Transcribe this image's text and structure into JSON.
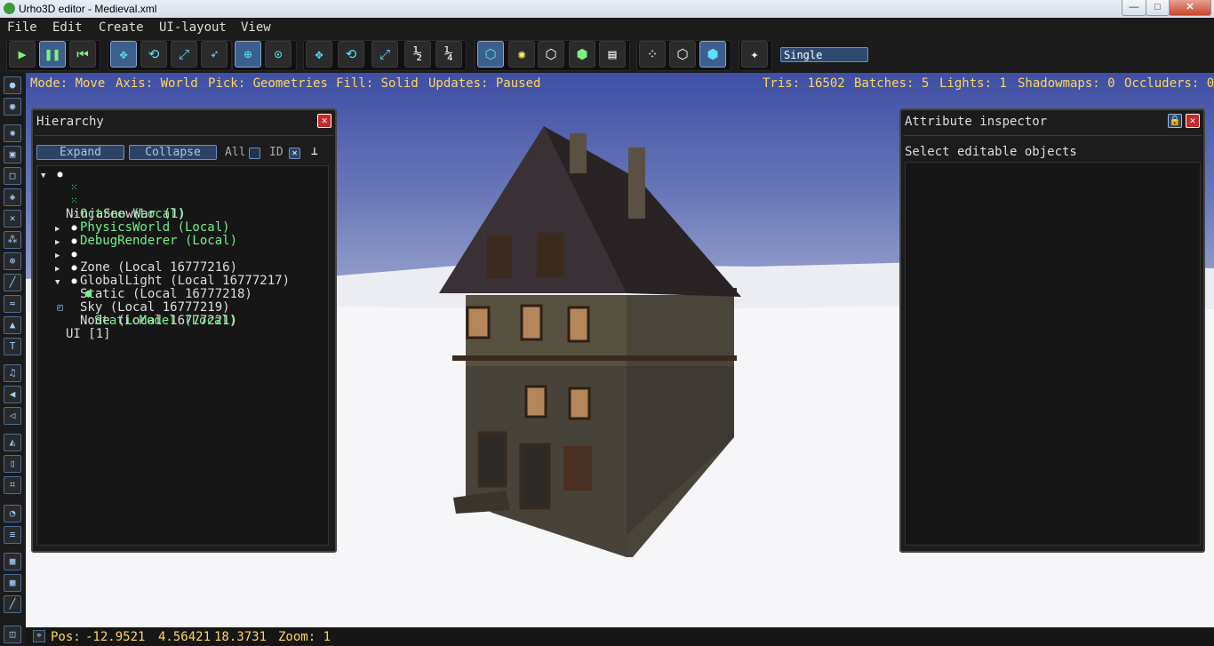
{
  "window": {
    "title": "Urho3D editor - Medieval.xml",
    "minimize_glyph": "—",
    "maximize_glyph": "□",
    "close_glyph": "✕"
  },
  "menu": [
    "File",
    "Edit",
    "Create",
    "UI-layout",
    "View"
  ],
  "toolbar": {
    "run_icons": [
      "play-icon",
      "pause-icon",
      "rewind-icon"
    ],
    "edit_mode_icons": [
      "move-gizmo-icon",
      "rotate-gizmo-icon",
      "scale-gizmo-icon",
      "select-gizmo-icon"
    ],
    "axis_icons": [
      "world-axis-icon",
      "local-axis-icon"
    ],
    "snap_icons": [
      "snap-move-icon",
      "snap-rotate-icon",
      "snap-scale-icon",
      "snap-half-icon",
      "snap-quarter-icon"
    ],
    "pick_icons": [
      "pick-geometry-icon",
      "pick-light-icon",
      "pick-zone-icon",
      "pick-rigidbody-icon",
      "pick-ui-icon"
    ],
    "fill_icons": [
      "fill-point-icon",
      "fill-wireframe-icon",
      "fill-solid-icon"
    ],
    "view_icons": [
      "view-mode-icon"
    ],
    "view_mode_value": "Single",
    "snap_half_label": "½",
    "snap_quarter_label": "¼"
  },
  "status": {
    "mode": "Mode: Move",
    "axis": "Axis: World",
    "pick": "Pick: Geometries",
    "fill": "Fill: Solid",
    "updates": "Updates: Paused",
    "tris": "Tris: 16502",
    "batches": "Batches: 5",
    "lights": "Lights: 1",
    "shadowmaps": "Shadowmaps: 0",
    "occluders": "Occluders: 0"
  },
  "hierarchy": {
    "title": "Hierarchy",
    "expand_label": "Expand",
    "collapse_label": "Collapse",
    "all_label": "All",
    "id_label": "ID",
    "items": [
      {
        "label": "NinjaSnowWar (1)",
        "type": "node",
        "icon": "node-icon",
        "expanded": true
      },
      {
        "label": "Octree (Local)",
        "type": "component",
        "icon": "octree-icon"
      },
      {
        "label": "PhysicsWorld (Local)",
        "type": "component",
        "icon": "physics-world-icon"
      },
      {
        "label": "DebugRenderer (Local)",
        "type": "component",
        "icon": "debug-renderer-icon"
      },
      {
        "label": "Zone (Local 16777216)",
        "type": "node",
        "icon": "node-icon",
        "expanded": false
      },
      {
        "label": "GlobalLight (Local 16777217)",
        "type": "node",
        "icon": "node-icon",
        "expanded": false
      },
      {
        "label": "Static (Local 16777218)",
        "type": "node",
        "icon": "node-icon",
        "expanded": false
      },
      {
        "label": "Sky (Local 16777219)",
        "type": "node",
        "icon": "node-icon",
        "expanded": false
      },
      {
        "label": "Node (Local 16777221)",
        "type": "node",
        "icon": "node-icon",
        "expanded": true
      },
      {
        "label": "StaticModel (Local)",
        "type": "component",
        "icon": "static-model-icon"
      },
      {
        "label": "UI [1]",
        "type": "ui",
        "icon": "ui-element-icon"
      }
    ]
  },
  "inspector": {
    "title": "Attribute inspector",
    "message": "Select editable objects"
  },
  "bottom": {
    "pos_label": "Pos:",
    "pos_x": "-12.9521",
    "pos_y": "4.56421",
    "pos_z": "18.3731",
    "zoom": "Zoom: 1"
  },
  "left_tools": [
    "node-icon",
    "scene-icon",
    "light-icon",
    "camera-icon",
    "box-icon",
    "model-icon",
    "skeleton-icon",
    "particles-icon",
    "navigation-icon",
    "rope-icon",
    "water-icon",
    "terrain-icon",
    "text-icon",
    "sound-icon",
    "sound-source-icon",
    "sound-listener-icon",
    "physics-icon",
    "collision-icon",
    "constraint-icon",
    "script-icon",
    "document-icon",
    "grid-icon",
    "grid2-icon",
    "path-icon"
  ]
}
